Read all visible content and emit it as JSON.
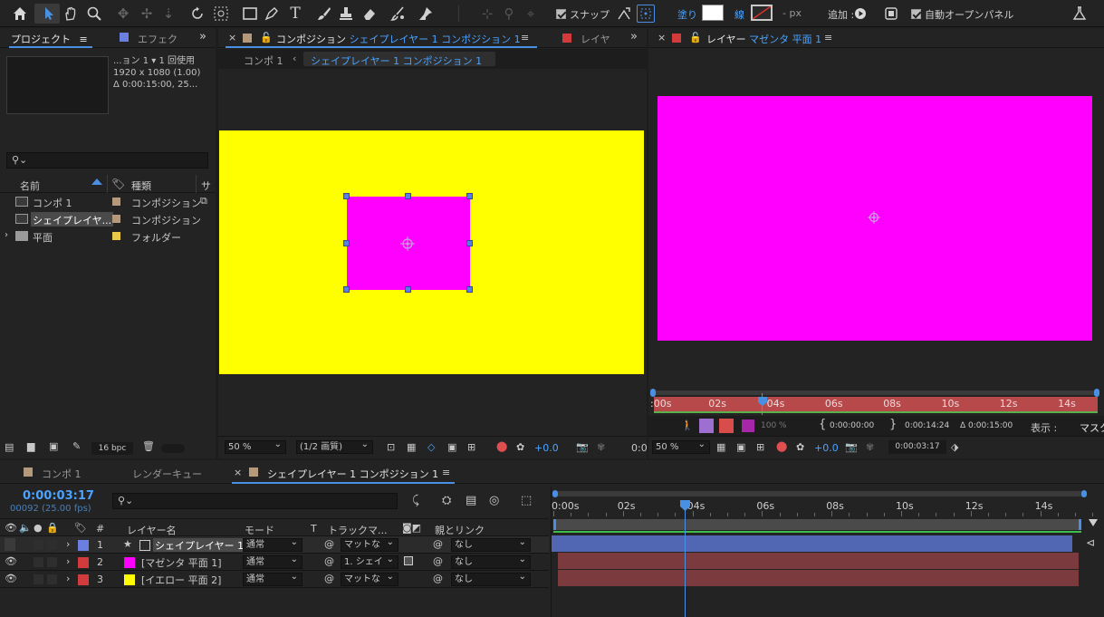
{
  "toolbar": {
    "snap_label": "スナップ",
    "fill_label": "塗り",
    "stroke_label": "線",
    "stroke_px": "- px",
    "add_label": "追加 :",
    "auto_open_label": "自動オープンパネル"
  },
  "project_panel": {
    "tab_project": "プロジェクト",
    "tab_effects": "エフェク",
    "info_line1": "...ョン 1 ▾ 1 回使用",
    "info_line2": "1920 x 1080 (1.00)",
    "info_line3": "Δ 0:00:15:00, 25...",
    "col_name": "名前",
    "col_type": "種類",
    "col_size": "サ",
    "items": [
      {
        "name": "コンポ 1",
        "type": "コンポジション",
        "color": "#b49a7a"
      },
      {
        "name": "シェイプレイヤ...",
        "type": "コンポジション",
        "color": "#b49a7a"
      },
      {
        "name": "平面",
        "type": "フォルダー",
        "color": "#e8c94a"
      }
    ],
    "bpc": "16 bpc"
  },
  "comp_viewer": {
    "tab_prefix": "コンポジション",
    "tab_name": "シェイプレイヤー 1 コンポジション 1",
    "tab_layer_short": "レイヤ",
    "crumb1": "コンポ 1",
    "crumb2": "シェイプレイヤー 1 コンポジション 1",
    "zoom": "50 %",
    "quality": "(1/2 画質)",
    "exposure": "+0.0",
    "timecode_stub": "0:0",
    "bg_color": "#ffff00",
    "shape_color": "#ff00ff"
  },
  "layer_viewer": {
    "tab_prefix": "レイヤー",
    "tab_name": "マゼンタ 平面 1",
    "ruler_labels": [
      ":00s",
      "02s",
      "04s",
      "06s",
      "08s",
      "10s",
      "12s",
      "14s"
    ],
    "opacity": "100 %",
    "in_point": "0:00:00:00",
    "out_point": "0:00:14:24",
    "duration": "Δ 0:00:15:00",
    "view_label": "表示 :",
    "view_value": "マスク",
    "zoom": "50 %",
    "exposure": "+0.0",
    "timecode": "0:00:03:17",
    "solid_color": "#ff00ff"
  },
  "timeline": {
    "tabs": [
      "コンポ 1",
      "レンダーキュー",
      "シェイプレイヤー 1 コンポジション 1"
    ],
    "timecode": "0:00:03:17",
    "frames": "00092 (25.00 fps)",
    "col_layer_name": "レイヤー名",
    "col_mode": "モード",
    "col_t": "T",
    "col_track_matte": "トラックマ...",
    "col_parent": "親とリンク",
    "col_num": "#",
    "ruler_labels": [
      "0:00s",
      "02s",
      "04s",
      "06s",
      "08s",
      "10s",
      "12s",
      "14s"
    ],
    "layers": [
      {
        "num": "1",
        "name": "シェイプレイヤー 1",
        "color": "#6a7fe0",
        "mode": "通常",
        "matte": "マットな",
        "parent": "なし"
      },
      {
        "num": "2",
        "name": "[マゼンタ 平面 1]",
        "color": "#ff00ff",
        "mode": "通常",
        "matte": "1. シェイ",
        "parent": "なし"
      },
      {
        "num": "3",
        "name": "[イエロー 平面 2]",
        "color": "#ffff00",
        "mode": "通常",
        "matte": "マットな",
        "parent": "なし"
      }
    ]
  }
}
